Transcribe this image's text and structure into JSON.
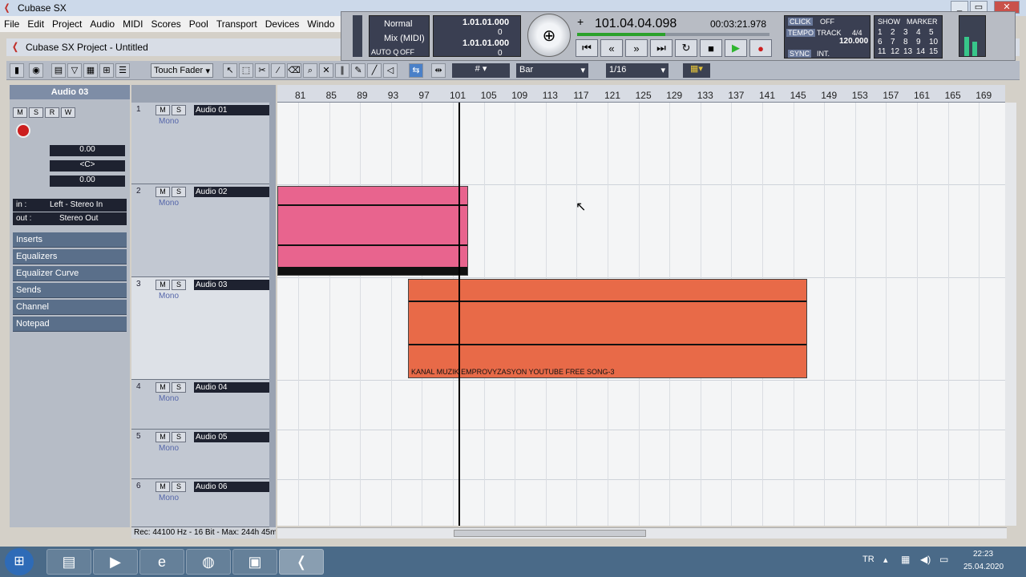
{
  "app": {
    "title": "Cubase SX",
    "window_title": "Cubase SX Project - Untitled"
  },
  "menu": [
    "File",
    "Edit",
    "Project",
    "Audio",
    "MIDI",
    "Scores",
    "Pool",
    "Transport",
    "Devices",
    "Windo"
  ],
  "transport": {
    "mode": "Normal",
    "mix": "Mix (MIDI)",
    "autoq": "AUTO Q",
    "autoq_val": "OFF",
    "left_locator": "1.01.01.000",
    "left_offset": "0",
    "right_locator": "1.01.01.000",
    "right_offset": "0",
    "position": "101.04.04.098",
    "time": "00:03:21.978",
    "click_label": "CLICK",
    "click_val": "OFF",
    "tempo_label": "TEMPO",
    "track_label": "TRACK",
    "signature": "4/4",
    "tempo": "120.000",
    "sync_label": "SYNC",
    "sync_val": "INT.",
    "show": "SHOW",
    "marker": "MARKER",
    "markers": [
      "1",
      "2",
      "3",
      "4",
      "5",
      "6",
      "7",
      "8",
      "9",
      "10",
      "11",
      "12",
      "13",
      "14",
      "15"
    ]
  },
  "toolbar": {
    "automation": "Touch Fader",
    "snap": "Bar",
    "quantize": "1/16"
  },
  "inspector": {
    "track_name": "Audio 03",
    "volume": "0.00",
    "pan": "<C>",
    "delay": "0.00",
    "in_label": "in :",
    "in_val": "Left - Stereo In",
    "out_label": "out :",
    "out_val": "Stereo Out",
    "sections": [
      "Inserts",
      "Equalizers",
      "Equalizer Curve",
      "Sends",
      "Channel",
      "Notepad"
    ]
  },
  "tracks": [
    {
      "num": "1",
      "name": "Audio 01",
      "mode": "Mono"
    },
    {
      "num": "2",
      "name": "Audio 02",
      "mode": "Mono"
    },
    {
      "num": "3",
      "name": "Audio 03",
      "mode": "Mono"
    },
    {
      "num": "4",
      "name": "Audio 04",
      "mode": "Mono"
    },
    {
      "num": "5",
      "name": "Audio 05",
      "mode": "Mono"
    },
    {
      "num": "6",
      "name": "Audio 06",
      "mode": "Mono"
    }
  ],
  "ruler": [
    "81",
    "85",
    "89",
    "93",
    "97",
    "101",
    "105",
    "109",
    "113",
    "117",
    "121",
    "125",
    "129",
    "133",
    "137",
    "141",
    "145",
    "149",
    "153",
    "157",
    "161",
    "165",
    "169"
  ],
  "events": {
    "track3_label": "KANAL MUZIK EMPROVYZASYON YOUTUBE FREE SONG-3"
  },
  "status": "Rec: 44100 Hz - 16 Bit - Max: 244h 45m",
  "systray": {
    "lang": "TR",
    "time": "22:23",
    "date": "25.04.2020"
  },
  "colors": {
    "event_pink": "#e8648e",
    "event_orange": "#e86a48",
    "cursor": "#000000",
    "play_green": "#2fb52f",
    "rec_red": "#cc1e1e"
  }
}
